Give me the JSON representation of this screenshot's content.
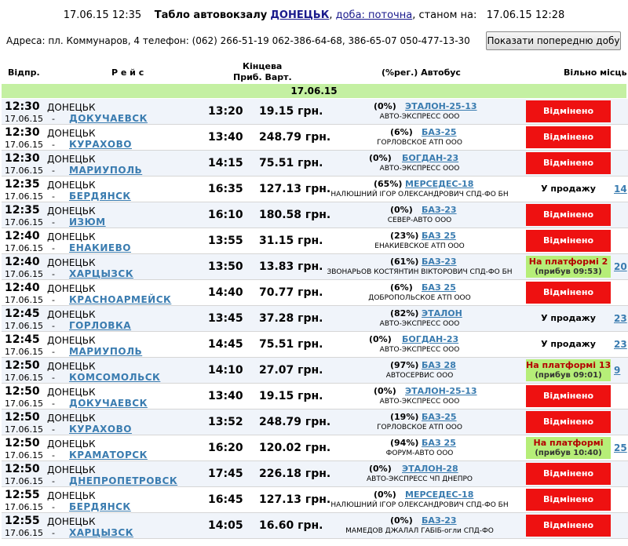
{
  "header": {
    "datetime": "17.06.15 12:35",
    "title_prefix": "Табло автовокзалу",
    "station": "ДОНЕЦЬК",
    "day_label": "доба: поточна",
    "as_of_label": ", станом на:",
    "as_of": "17.06.15 12:28"
  },
  "address": "Адреса: пл. Коммунаров, 4    телефон: (062) 266-51-19 062-386-64-68, 386-65-07 050-477-13-30",
  "prev_day_button": "Показати попередню добу",
  "columns": {
    "dep": "Відпр.",
    "route": "Р е й с",
    "final": "Кінцева",
    "arr_price": "Приб.  Варт.",
    "bus": "(%рег.) Автобус",
    "seats": "Вільно місць"
  },
  "date_band": "17.06.15",
  "rows": [
    {
      "dep": "12:30",
      "origin": "ДОНЕЦЬК",
      "date": "17.06.15",
      "dest": "ДОКУЧАЕВСК",
      "arr": "13:20",
      "price": "19.15 грн.",
      "pct": "(0%)",
      "bus": "ЭТАЛОН-25-13",
      "carrier": "АВТО-ЭКСПРЕСС ООО",
      "status": "Відмінено",
      "status_sub": "",
      "kind": "cancel",
      "seats": ""
    },
    {
      "dep": "12:30",
      "origin": "ДОНЕЦЬК",
      "date": "17.06.15",
      "dest": "КУРАХОВО",
      "arr": "13:40",
      "price": "248.79 грн.",
      "pct": "(6%)",
      "bus": "БАЗ-25",
      "carrier": "ГОРЛОВСКОЕ АТП ООО",
      "status": "Відмінено",
      "status_sub": "",
      "kind": "cancel",
      "seats": ""
    },
    {
      "dep": "12:30",
      "origin": "ДОНЕЦЬК",
      "date": "17.06.15",
      "dest": "МАРИУПОЛЬ",
      "arr": "14:15",
      "price": "75.51 грн.",
      "pct": "(0%)",
      "bus": "БОГДАН-23",
      "carrier": "АВТО-ЭКСПРЕСС ООО",
      "status": "Відмінено",
      "status_sub": "",
      "kind": "cancel",
      "seats": ""
    },
    {
      "dep": "12:35",
      "origin": "ДОНЕЦЬК",
      "date": "17.06.15",
      "dest": "БЕРДЯНСК",
      "arr": "16:35",
      "price": "127.13 грн.",
      "pct": "(65%)",
      "bus": "МЕРСЕДЕС-18",
      "carrier": "НАЛЮШНИЙ ІГОР ОЛЕКСАНДРОВИЧ СПД-ФО БН",
      "status": "У продажу",
      "status_sub": "",
      "kind": "sale",
      "seats": "14"
    },
    {
      "dep": "12:35",
      "origin": "ДОНЕЦЬК",
      "date": "17.06.15",
      "dest": "ИЗЮМ",
      "arr": "16:10",
      "price": "180.58 грн.",
      "pct": "(0%)",
      "bus": "БАЗ-23",
      "carrier": "СЕВЕР-АВТО ООО",
      "status": "Відмінено",
      "status_sub": "",
      "kind": "cancel",
      "seats": ""
    },
    {
      "dep": "12:40",
      "origin": "ДОНЕЦЬК",
      "date": "17.06.15",
      "dest": "ЕНАКИЕВО",
      "arr": "13:55",
      "price": "31.15 грн.",
      "pct": "(23%)",
      "bus": "БАЗ 25",
      "carrier": "ЕНАКИЕВСКОЕ АТП ООО",
      "status": "Відмінено",
      "status_sub": "",
      "kind": "cancel",
      "seats": ""
    },
    {
      "dep": "12:40",
      "origin": "ДОНЕЦЬК",
      "date": "17.06.15",
      "dest": "ХАРЦЫЗСК",
      "arr": "13:50",
      "price": "13.83 грн.",
      "pct": "(61%)",
      "bus": "БАЗ-23",
      "carrier": "ЗВОНАРЬОВ КОСТЯНТИН ВІКТОРОВИЧ СПД-ФО БН",
      "status": "На платформі 2",
      "status_sub": "(прибув 09:53)",
      "kind": "platform",
      "seats": "20"
    },
    {
      "dep": "12:40",
      "origin": "ДОНЕЦЬК",
      "date": "17.06.15",
      "dest": "КРАСНОАРМЕЙСК",
      "arr": "14:40",
      "price": "70.77 грн.",
      "pct": "(6%)",
      "bus": "БАЗ 25",
      "carrier": "ДОБРОПОЛЬСКОЕ АТП ООО",
      "status": "Відмінено",
      "status_sub": "",
      "kind": "cancel",
      "seats": ""
    },
    {
      "dep": "12:45",
      "origin": "ДОНЕЦЬК",
      "date": "17.06.15",
      "dest": "ГОРЛОВКА",
      "arr": "13:45",
      "price": "37.28 грн.",
      "pct": "(82%)",
      "bus": "ЭТАЛОН",
      "carrier": "АВТО-ЭКСПРЕСС ООО",
      "status": "У продажу",
      "status_sub": "",
      "kind": "sale",
      "seats": "23"
    },
    {
      "dep": "12:45",
      "origin": "ДОНЕЦЬК",
      "date": "17.06.15",
      "dest": "МАРИУПОЛЬ",
      "arr": "14:45",
      "price": "75.51 грн.",
      "pct": "(0%)",
      "bus": "БОГДАН-23",
      "carrier": "АВТО-ЭКСПРЕСС ООО",
      "status": "У продажу",
      "status_sub": "",
      "kind": "sale",
      "seats": "23"
    },
    {
      "dep": "12:50",
      "origin": "ДОНЕЦЬК",
      "date": "17.06.15",
      "dest": "КОМСОМОЛЬСК",
      "arr": "14:10",
      "price": "27.07 грн.",
      "pct": "(97%)",
      "bus": "БАЗ 28",
      "carrier": "АВТОСЕРВИС ООО",
      "status": "На платформі 13",
      "status_sub": "(прибув 09:01)",
      "kind": "platform",
      "seats": "9"
    },
    {
      "dep": "12:50",
      "origin": "ДОНЕЦЬК",
      "date": "17.06.15",
      "dest": "ДОКУЧАЕВСК",
      "arr": "13:40",
      "price": "19.15 грн.",
      "pct": "(0%)",
      "bus": "ЭТАЛОН-25-13",
      "carrier": "АВТО-ЭКСПРЕСС ООО",
      "status": "Відмінено",
      "status_sub": "",
      "kind": "cancel",
      "seats": ""
    },
    {
      "dep": "12:50",
      "origin": "ДОНЕЦЬК",
      "date": "17.06.15",
      "dest": "КУРАХОВО",
      "arr": "13:52",
      "price": "248.79 грн.",
      "pct": "(19%)",
      "bus": "БАЗ-25",
      "carrier": "ГОРЛОВСКОЕ АТП ООО",
      "status": "Відмінено",
      "status_sub": "",
      "kind": "cancel",
      "seats": ""
    },
    {
      "dep": "12:50",
      "origin": "ДОНЕЦЬК",
      "date": "17.06.15",
      "dest": "КРАМАТОРСК",
      "arr": "16:20",
      "price": "120.02 грн.",
      "pct": "(94%)",
      "bus": "БАЗ 25",
      "carrier": "ФОРУМ-АВТО ООО",
      "status": "На платформі",
      "status_sub": "(прибув 10:40)",
      "kind": "platform",
      "seats": "25"
    },
    {
      "dep": "12:50",
      "origin": "ДОНЕЦЬК",
      "date": "17.06.15",
      "dest": "ДНЕПРОПЕТРОВСК",
      "arr": "17:45",
      "price": "226.18 грн.",
      "pct": "(0%)",
      "bus": "ЭТАЛОН-28",
      "carrier": "АВТО-ЭКСПРЕСС ЧП ДНЕПРО",
      "status": "Відмінено",
      "status_sub": "",
      "kind": "cancel",
      "seats": ""
    },
    {
      "dep": "12:55",
      "origin": "ДОНЕЦЬК",
      "date": "17.06.15",
      "dest": "БЕРДЯНСК",
      "arr": "16:45",
      "price": "127.13 грн.",
      "pct": "(0%)",
      "bus": "МЕРСЕДЕС-18",
      "carrier": "НАЛЮШНИЙ ІГОР ОЛЕКСАНДРОВИЧ СПД-ФО БН",
      "status": "Відмінено",
      "status_sub": "",
      "kind": "cancel",
      "seats": ""
    },
    {
      "dep": "12:55",
      "origin": "ДОНЕЦЬК",
      "date": "17.06.15",
      "dest": "ХАРЦЫЗСК",
      "arr": "14:05",
      "price": "16.60 грн.",
      "pct": "(0%)",
      "bus": "БАЗ-23",
      "carrier": "МАМЕДОВ ДЖАЛАЛ ГАБІБ-огли СПД-ФО",
      "status": "Відмінено",
      "status_sub": "",
      "kind": "cancel",
      "seats": ""
    }
  ]
}
